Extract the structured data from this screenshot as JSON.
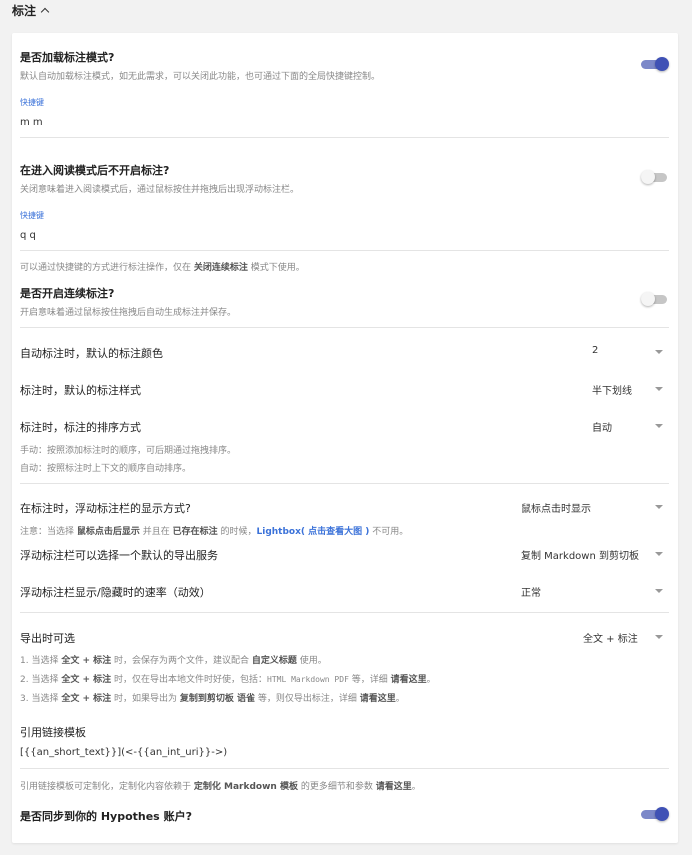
{
  "section": {
    "title": "标注"
  },
  "load_mode": {
    "title": "是否加载标注模式?",
    "desc": "默认自动加载标注模式，如无此需求，可以关闭此功能，也可通过下面的全局快捷键控制。",
    "shortcut_label": "快捷键",
    "shortcut_value": "m m",
    "enabled": true
  },
  "reading_mode": {
    "title": "在进入阅读模式后不开启标注?",
    "desc": "关闭意味着进入阅读模式后，通过鼠标按住并拖拽后出现浮动标注栏。",
    "shortcut_label": "快捷键",
    "shortcut_value": "q q",
    "enabled": false
  },
  "continuous": {
    "note_pre": "可以通过快捷键的方式进行标注操作，仅在 ",
    "note_bold": "关闭连续标注",
    "note_post": " 模式下使用。",
    "title": "是否开启连续标注?",
    "desc": "开启意味着通过鼠标按住拖拽后自动生成标注并保存。",
    "enabled": false
  },
  "auto_color": {
    "title": "自动标注时，默认的标注颜色",
    "value": "2"
  },
  "default_style": {
    "title": "标注时，默认的标注样式",
    "value": "半下划线"
  },
  "sort_mode": {
    "title": "标注时，标注的排序方式",
    "value": "自动",
    "desc1": "手动：按照添加标注时的顺序，可后期通过拖拽排序。",
    "desc2": "自动：按照标注时上下文的顺序自动排序。"
  },
  "float_display": {
    "title": "在标注时，浮动标注栏的显示方式?",
    "value": "鼠标点击时显示",
    "note_a": "注意：当选择 ",
    "note_b": "鼠标点击后显示",
    "note_c": " 并且在 ",
    "note_d": "已存在标注",
    "note_e": " 的时候，",
    "note_link": "Lightbox( 点击查看大图 )",
    "note_f": " 不可用。"
  },
  "export_service": {
    "title": "浮动标注栏可以选择一个默认的导出服务",
    "value": "复制 Markdown 到剪切板"
  },
  "speed": {
    "title": "浮动标注栏显示/隐藏时的速率（动效）",
    "value": "正常"
  },
  "export_opt": {
    "title": "导出时可选",
    "value": "全文 + 标注",
    "l1_a": "1. 当选择 ",
    "l1_b": "全文 + 标注",
    "l1_c": " 时，会保存为两个文件，建议配合 ",
    "l1_link": "自定义标题",
    "l1_d": " 使用。",
    "l2_a": "2. 当选择 ",
    "l2_b": "全文 + 标注",
    "l2_c": " 时，仅在导出本地文件时好使，包括：",
    "l2_mono": "HTML Markdown PDF",
    "l2_d": " 等，详细 ",
    "l2_link": "请看这里",
    "l2_e": "。",
    "l3_a": "3. 当选择 ",
    "l3_b": "全文 + 标注",
    "l3_c": " 时，如果导出为 ",
    "l3_d": "复制到剪切板 语雀",
    "l3_e": " 等，则仅导出标注，详细 ",
    "l3_link": "请看这里",
    "l3_f": "。"
  },
  "citation": {
    "title": "引用链接模板",
    "template": "[{{an_short_text}}](<-{{an_int_uri}}->)",
    "note_a": "引用链接模板可定制化，定制化内容依赖于 ",
    "note_bold": "定制化 Markdown 模板",
    "note_b": " 的更多细节和参数 ",
    "note_link": "请看这里",
    "note_c": "。"
  },
  "hypothes": {
    "title": "是否同步到你的 Hypothes 账户?",
    "enabled": true
  }
}
